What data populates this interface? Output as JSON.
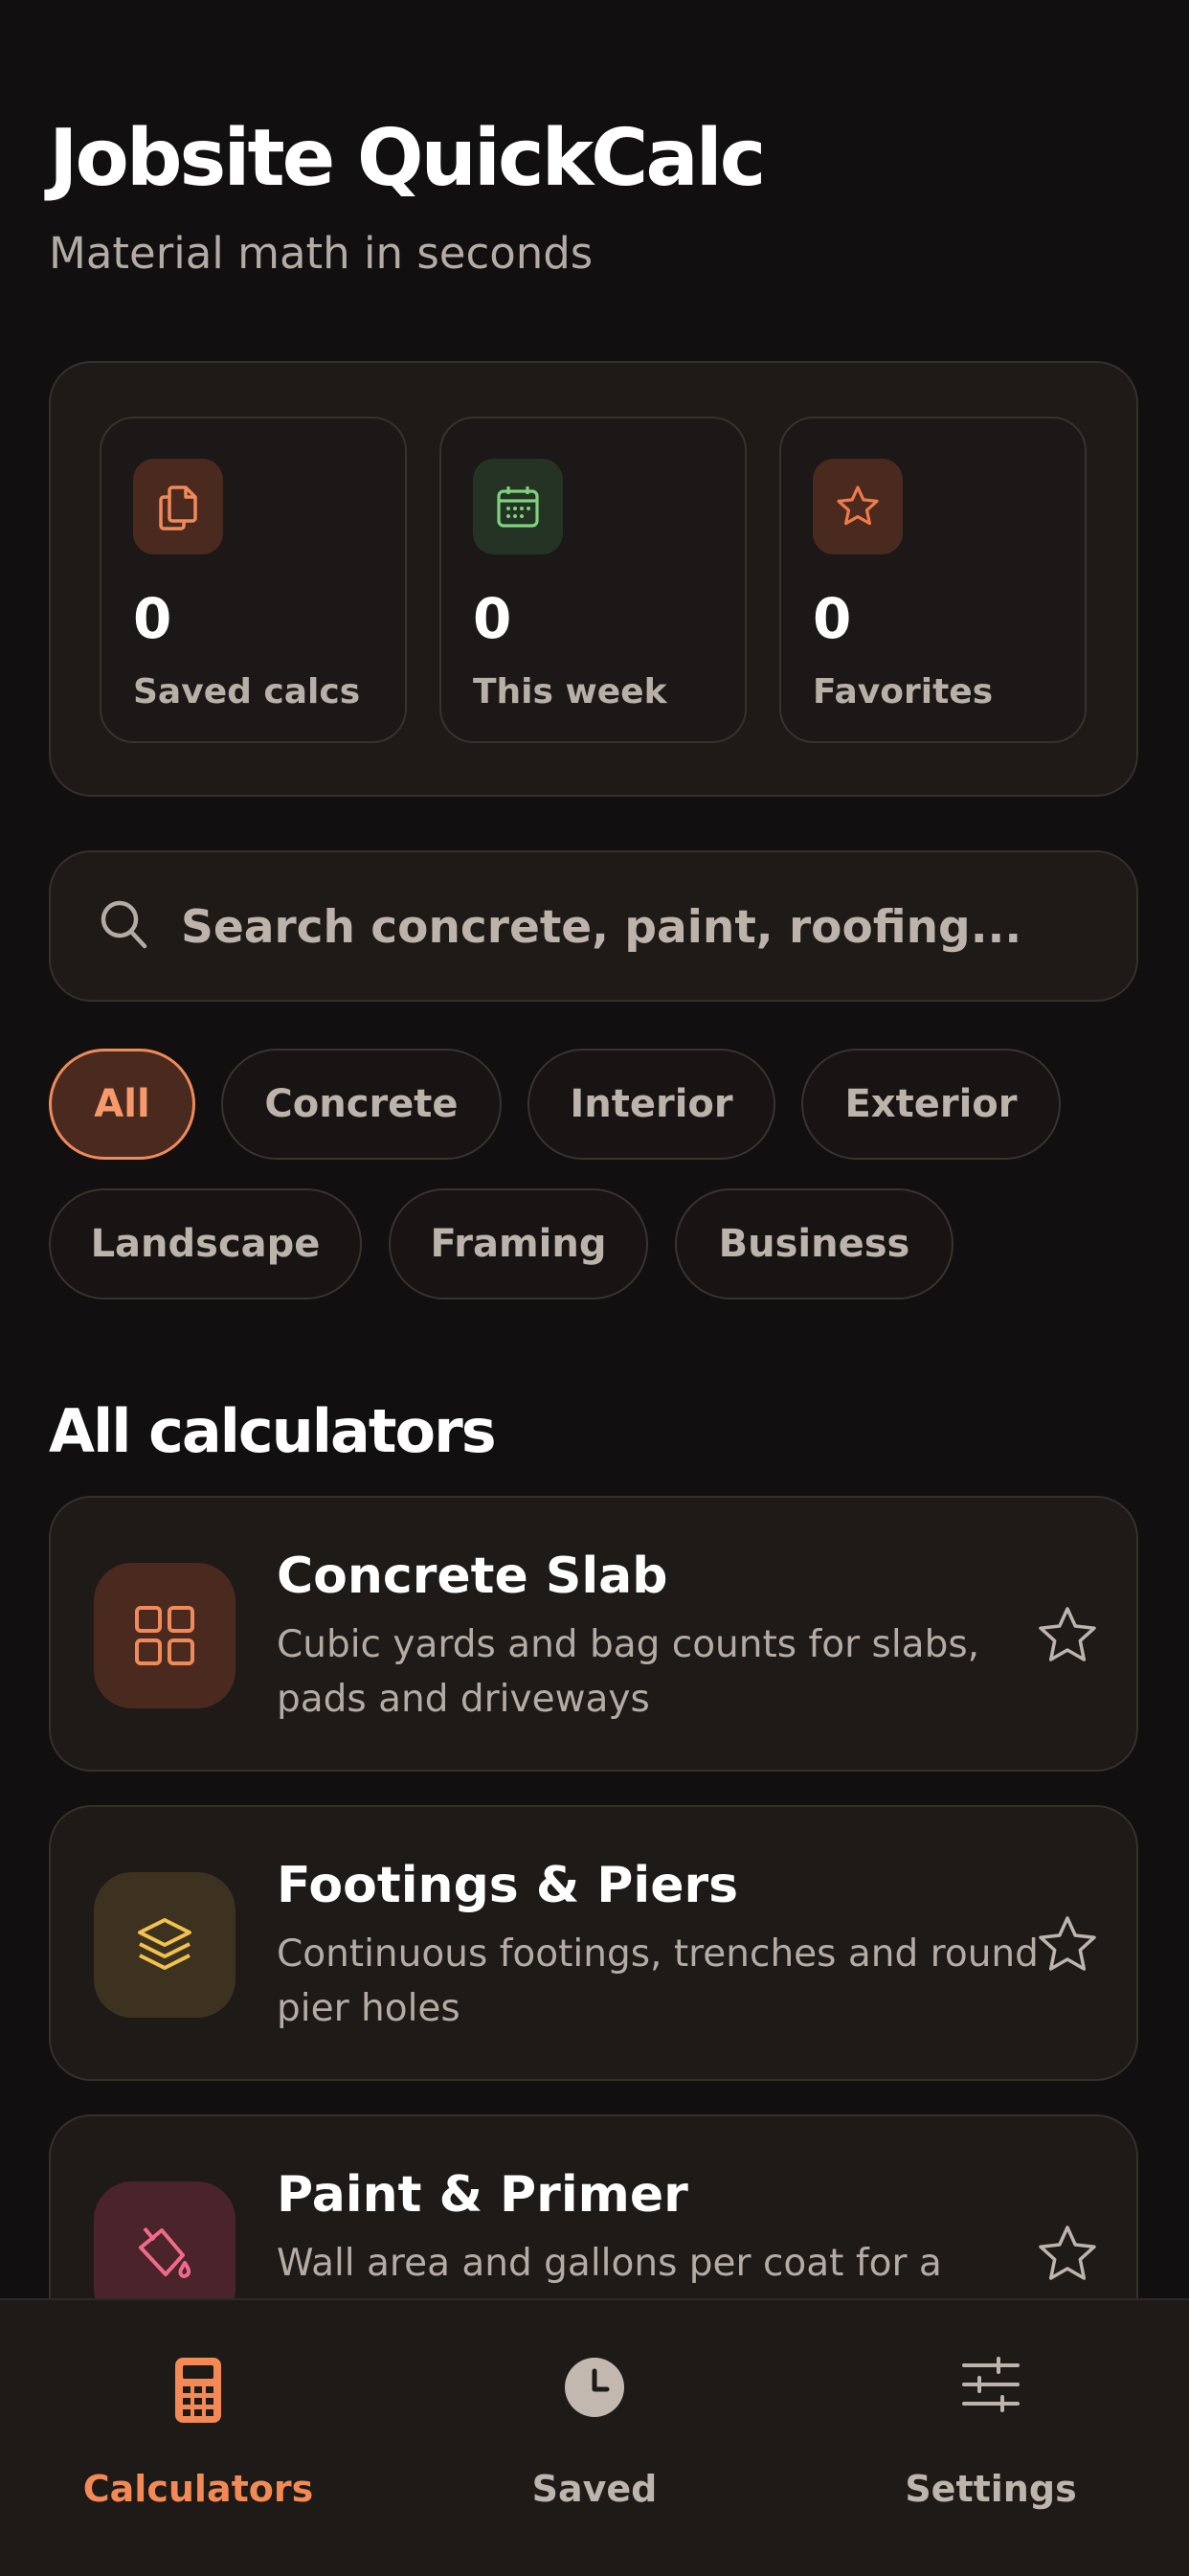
{
  "header": {
    "title": "Jobsite QuickCalc",
    "subtitle": "Material math in seconds"
  },
  "stats": [
    {
      "value": "0",
      "label": "Saved calcs",
      "icon": "documents-icon",
      "color": "#f08a5a",
      "bg": "#4a2a1f"
    },
    {
      "value": "0",
      "label": "This week",
      "icon": "calendar-icon",
      "color": "#7fd27f",
      "bg": "#243324"
    },
    {
      "value": "0",
      "label": "Favorites",
      "icon": "star-icon",
      "color": "#f07a4a",
      "bg": "#4a2a1f"
    }
  ],
  "search": {
    "placeholder": "Search concrete, paint, roofing..."
  },
  "filters": {
    "active": "All",
    "items": [
      "All",
      "Concrete",
      "Interior",
      "Exterior",
      "Landscape",
      "Framing",
      "Business"
    ]
  },
  "section": {
    "title": "All calculators"
  },
  "calculators": [
    {
      "title": "Concrete Slab",
      "desc": "Cubic yards and bag counts for slabs, pads and driveways",
      "icon": "grid-icon",
      "color": "#f08a5a",
      "bg": "#4a2a1f"
    },
    {
      "title": "Footings & Piers",
      "desc": "Continuous footings, trenches and round pier holes",
      "icon": "layers-icon",
      "color": "#f2c14e",
      "bg": "#3c321f"
    },
    {
      "title": "Paint & Primer",
      "desc": "Wall area and gallons per coat for a",
      "icon": "paint-bucket-icon",
      "color": "#f06a8a",
      "bg": "#4a232b"
    }
  ],
  "tabs": [
    {
      "label": "Calculators",
      "icon": "calculator-icon",
      "active": true
    },
    {
      "label": "Saved",
      "icon": "clock-icon",
      "active": false
    },
    {
      "label": "Settings",
      "icon": "sliders-icon",
      "active": false
    }
  ],
  "colors": {
    "accent": "#f38a55",
    "background": "#110f10",
    "card": "#1e1a18"
  }
}
